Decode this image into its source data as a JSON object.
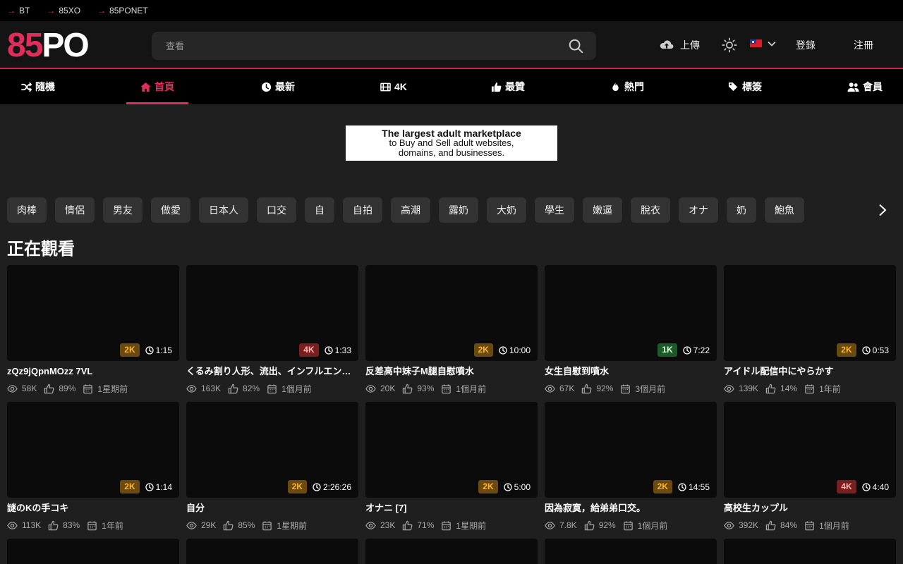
{
  "toplinks": [
    {
      "label": "BT"
    },
    {
      "label": "85XO"
    },
    {
      "label": "85PONET"
    }
  ],
  "logo": {
    "part1": "85",
    "part2": "PO"
  },
  "search": {
    "placeholder": "查看"
  },
  "header": {
    "upload_label": "上傳",
    "login_label": "登錄",
    "register_label": "注冊"
  },
  "nav": {
    "items": [
      {
        "label": "隨機",
        "icon": "shuffle-icon"
      },
      {
        "label": "首頁",
        "icon": "home-icon"
      },
      {
        "label": "最新",
        "icon": "clock-icon"
      },
      {
        "label": "4K",
        "icon": "film-icon"
      },
      {
        "label": "最贊",
        "icon": "thumbs-up-icon"
      },
      {
        "label": "熱門",
        "icon": "fire-icon"
      },
      {
        "label": "標簽",
        "icon": "tags-icon"
      },
      {
        "label": "會員",
        "icon": "users-icon"
      }
    ],
    "active_index": 1
  },
  "banner": {
    "line1": "The largest adult marketplace",
    "line2": "to Buy and Sell adult websites,",
    "line3": "domains, and businesses."
  },
  "tags": [
    "肉棒",
    "情侶",
    "男友",
    "做愛",
    "日本人",
    "口交",
    "自",
    "自拍",
    "高潮",
    "露奶",
    "大奶",
    "學生",
    "嫩逼",
    "脫衣",
    "オナ",
    "奶",
    "鮑魚"
  ],
  "section": {
    "title": "正在觀看"
  },
  "videos": [
    {
      "quality": "2K",
      "duration": "1:15",
      "title": "zQz9jQpnMOzz 7VL",
      "views": "58K",
      "rating": "89%",
      "age": "1星期前"
    },
    {
      "quality": "4K",
      "duration": "1:33",
      "title": "くるみ割り人形、流出、インフルエンサー、素人",
      "views": "163K",
      "rating": "82%",
      "age": "1個月前"
    },
    {
      "quality": "2K",
      "duration": "10:00",
      "title": "反差高中妹子M腿自慰噴水",
      "views": "20K",
      "rating": "93%",
      "age": "1個月前"
    },
    {
      "quality": "1K",
      "duration": "7:22",
      "title": "女生自慰到噴水",
      "views": "67K",
      "rating": "92%",
      "age": "3個月前"
    },
    {
      "quality": "2K",
      "duration": "0:53",
      "title": "アイドル配信中にやらかす",
      "views": "139K",
      "rating": "14%",
      "age": "1年前"
    },
    {
      "quality": "2K",
      "duration": "1:14",
      "title": "謎のKの手コキ",
      "views": "113K",
      "rating": "83%",
      "age": "1年前"
    },
    {
      "quality": "2K",
      "duration": "2:26:26",
      "title": "自分",
      "views": "29K",
      "rating": "85%",
      "age": "1星期前"
    },
    {
      "quality": "2K",
      "duration": "5:00",
      "title": "オナニ [7]",
      "views": "23K",
      "rating": "71%",
      "age": "1星期前"
    },
    {
      "quality": "2K",
      "duration": "14:55",
      "title": "因為寂寞，給弟弟口交。",
      "views": "7.8K",
      "rating": "92%",
      "age": "1個月前"
    },
    {
      "quality": "4K",
      "duration": "4:40",
      "title": "高校生カップル",
      "views": "392K",
      "rating": "84%",
      "age": "1個月前"
    }
  ],
  "colors": {
    "accent": "#e02d5a",
    "q2k": "#ffb52e",
    "q4k": "#7a1f1f",
    "q1k": "#1d5a2a"
  }
}
